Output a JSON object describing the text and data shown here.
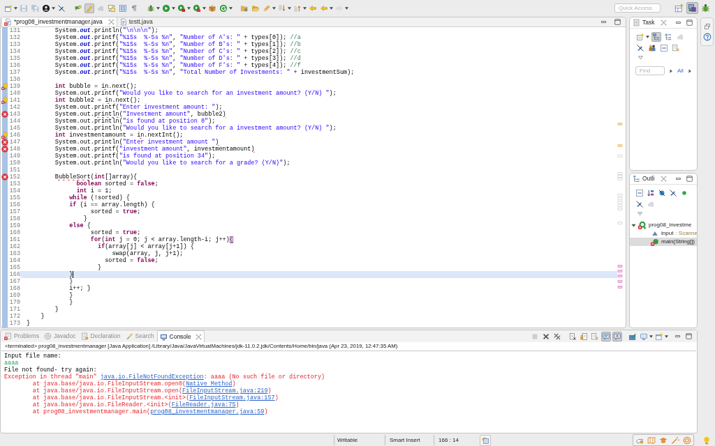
{
  "main_toolbar": [
    {
      "pressed": false,
      "disabled": false
    },
    {
      "pressed": false,
      "disabled": true
    },
    {
      "pressed": false,
      "disabled": true
    },
    {
      "pressed": false,
      "disabled": false
    },
    {
      "pressed": false,
      "disabled": false
    },
    {
      "pressed": false,
      "disabled": false
    },
    {
      "pressed": true,
      "disabled": false
    },
    {
      "pressed": false,
      "disabled": true
    },
    {
      "pressed": false,
      "disabled": false
    },
    {
      "pressed": false,
      "disabled": false
    },
    {
      "pressed": false,
      "disabled": false
    },
    {
      "pressed": false,
      "disabled": false
    },
    {
      "pressed": false,
      "disabled": false
    },
    {
      "pressed": false,
      "disabled": false
    },
    {
      "pressed": false,
      "disabled": false
    },
    {
      "pressed": false,
      "disabled": false
    },
    {
      "pressed": false,
      "disabled": false
    },
    {
      "pressed": false,
      "disabled": false
    },
    {
      "pressed": false,
      "disabled": false
    },
    {
      "pressed": false,
      "disabled": false
    },
    {
      "pressed": false,
      "disabled": false
    },
    {
      "pressed": false,
      "disabled": false
    },
    {
      "pressed": false,
      "disabled": false
    },
    {
      "pressed": false,
      "disabled": false
    },
    {
      "pressed": false,
      "disabled": true
    }
  ],
  "quick_access": {
    "placeholder": "Quick Access"
  },
  "perspectives": [
    {
      "selected": false
    },
    {
      "selected": true
    },
    {
      "selected": false
    }
  ],
  "editor": {
    "tabs": [
      {
        "label": "*prog08_investmentmanager.java",
        "selected": true,
        "error": true
      },
      {
        "label": "testt.java",
        "selected": false,
        "error": false
      }
    ],
    "lines": [
      {
        "number": "131",
        "current": false,
        "code": [
          {
            "kind": "plain",
            "text": "        System."
          },
          {
            "kind": "field",
            "text": "out"
          },
          {
            "kind": "plain",
            "text": ".println("
          },
          {
            "kind": "string",
            "text": "\"\\n\\n\\n\""
          },
          {
            "kind": "plain",
            "text": ");"
          }
        ]
      },
      {
        "number": "132",
        "current": false,
        "code": [
          {
            "kind": "plain",
            "text": "        System."
          },
          {
            "kind": "field",
            "text": "out"
          },
          {
            "kind": "plain",
            "text": ".printf("
          },
          {
            "kind": "string",
            "text": "\"%15s  %-5s %n\""
          },
          {
            "kind": "plain",
            "text": ", "
          },
          {
            "kind": "string",
            "text": "\"Number of A's: \""
          },
          {
            "kind": "plain",
            "text": " + types[0]); "
          },
          {
            "kind": "comment",
            "text": "//a"
          }
        ]
      },
      {
        "number": "133",
        "current": false,
        "code": [
          {
            "kind": "plain",
            "text": "        System."
          },
          {
            "kind": "field",
            "text": "out"
          },
          {
            "kind": "plain",
            "text": ".printf("
          },
          {
            "kind": "string",
            "text": "\"%15s  %-5s %n\""
          },
          {
            "kind": "plain",
            "text": ", "
          },
          {
            "kind": "string",
            "text": "\"Number of B's: \""
          },
          {
            "kind": "plain",
            "text": " + types[1]); "
          },
          {
            "kind": "comment",
            "text": "//b"
          }
        ]
      },
      {
        "number": "134",
        "current": false,
        "code": [
          {
            "kind": "plain",
            "text": "        System."
          },
          {
            "kind": "field",
            "text": "out"
          },
          {
            "kind": "plain",
            "text": ".printf("
          },
          {
            "kind": "string",
            "text": "\"%15s  %-5s %n\""
          },
          {
            "kind": "plain",
            "text": ", "
          },
          {
            "kind": "string",
            "text": "\"Number of C's: \""
          },
          {
            "kind": "plain",
            "text": " + types[2]); "
          },
          {
            "kind": "comment",
            "text": "//c"
          }
        ]
      },
      {
        "number": "135",
        "current": false,
        "code": [
          {
            "kind": "plain",
            "text": "        System."
          },
          {
            "kind": "field",
            "text": "out"
          },
          {
            "kind": "plain",
            "text": ".printf("
          },
          {
            "kind": "string",
            "text": "\"%15s  %-5s %n\""
          },
          {
            "kind": "plain",
            "text": ", "
          },
          {
            "kind": "string",
            "text": "\"Number of D's: \""
          },
          {
            "kind": "plain",
            "text": " + types[3]); "
          },
          {
            "kind": "comment",
            "text": "//d"
          }
        ]
      },
      {
        "number": "136",
        "current": false,
        "code": [
          {
            "kind": "plain",
            "text": "        System."
          },
          {
            "kind": "field",
            "text": "out"
          },
          {
            "kind": "plain",
            "text": ".printf("
          },
          {
            "kind": "string",
            "text": "\"%15s  %-5s %n\""
          },
          {
            "kind": "plain",
            "text": ", "
          },
          {
            "kind": "string",
            "text": "\"Number of F's: \""
          },
          {
            "kind": "plain",
            "text": " + types[4]); "
          },
          {
            "kind": "comment",
            "text": "//f"
          }
        ]
      },
      {
        "number": "137",
        "current": false,
        "code": [
          {
            "kind": "plain",
            "text": "        System."
          },
          {
            "kind": "field",
            "text": "out"
          },
          {
            "kind": "plain",
            "text": ".printf("
          },
          {
            "kind": "string",
            "text": "\"%15s  %-5s %n\""
          },
          {
            "kind": "plain",
            "text": ", "
          },
          {
            "kind": "string",
            "text": "\"Total Number of Investments: \""
          },
          {
            "kind": "plain",
            "text": " + investmentSum);"
          }
        ]
      },
      {
        "number": "138",
        "current": false
      },
      {
        "number": "139",
        "current": false,
        "marker": {
          "kind": "quickfix"
        },
        "code": [
          {
            "kind": "keyword",
            "text": "        int"
          },
          {
            "kind": "plain",
            "text": " bubble = "
          },
          {
            "kind": "error",
            "text": "in"
          },
          {
            "kind": "plain",
            "text": ".next();"
          }
        ]
      },
      {
        "number": "140",
        "current": false,
        "code": [
          {
            "kind": "plain",
            "text": "        System.out.printf("
          },
          {
            "kind": "string",
            "text": "\"Would you like to search for an investment amount? (Y/N) \""
          },
          {
            "kind": "plain",
            "text": ");"
          }
        ]
      },
      {
        "number": "141",
        "current": false,
        "marker": {
          "kind": "quickfix"
        },
        "code": [
          {
            "kind": "keyword",
            "text": "        int"
          },
          {
            "kind": "plain",
            "text": " bubble2 = "
          },
          {
            "kind": "error",
            "text": "in"
          },
          {
            "kind": "plain",
            "text": ".next();"
          }
        ]
      },
      {
        "number": "142",
        "current": false,
        "code": [
          {
            "kind": "plain",
            "text": "        System.out.printf("
          },
          {
            "kind": "string",
            "text": "\"Enter investment amount: \""
          },
          {
            "kind": "plain",
            "text": ");"
          }
        ]
      },
      {
        "number": "143",
        "current": false,
        "marker": {
          "kind": "error"
        },
        "code": [
          {
            "kind": "plain",
            "text": "        System.out."
          },
          {
            "kind": "error",
            "text": "println"
          },
          {
            "kind": "plain",
            "text": "("
          },
          {
            "kind": "string",
            "text": "\"Investment amount\""
          },
          {
            "kind": "plain",
            "text": ", bubble2"
          },
          {
            "kind": "error",
            "text": ")"
          }
        ]
      },
      {
        "number": "144",
        "current": false,
        "code": [
          {
            "kind": "plain",
            "text": "        System.out.println("
          },
          {
            "kind": "string",
            "text": "\"is found at position 0\""
          },
          {
            "kind": "plain",
            "text": ");"
          }
        ]
      },
      {
        "number": "145",
        "current": false,
        "code": [
          {
            "kind": "plain",
            "text": "        System.out.println("
          },
          {
            "kind": "string",
            "text": "\"Would you like to search for a investment amount? (Y/N) \""
          },
          {
            "kind": "plain",
            "text": ");"
          }
        ]
      },
      {
        "number": "146",
        "current": false,
        "marker": {
          "kind": "quickfix"
        },
        "code": [
          {
            "kind": "keyword",
            "text": "        int"
          },
          {
            "kind": "plain",
            "text": " investmentamount = "
          },
          {
            "kind": "error",
            "text": "in"
          },
          {
            "kind": "plain",
            "text": ".nextInt();"
          }
        ]
      },
      {
        "number": "147",
        "current": false,
        "marker": {
          "kind": "error"
        },
        "code": [
          {
            "kind": "plain",
            "text": "        System.out.println("
          },
          {
            "kind": "string",
            "text": "\"Enter investment amount \""
          },
          {
            "kind": "error",
            "text": ")"
          }
        ]
      },
      {
        "number": "148",
        "current": false,
        "marker": {
          "kind": "error"
        },
        "code": [
          {
            "kind": "plain",
            "text": "        System.out.printf("
          },
          {
            "kind": "string",
            "text": "\"investment amount\""
          },
          {
            "kind": "plain",
            "text": ", investmentamount"
          },
          {
            "kind": "error",
            "text": ")"
          }
        ]
      },
      {
        "number": "149",
        "current": false,
        "code": [
          {
            "kind": "plain",
            "text": "        System.out.printf("
          },
          {
            "kind": "string",
            "text": "\"is found at position 34\""
          },
          {
            "kind": "plain",
            "text": ");"
          }
        ]
      },
      {
        "number": "150",
        "current": false,
        "code": [
          {
            "kind": "plain",
            "text": "        System.out.println("
          },
          {
            "kind": "string",
            "text": "\"Would you like to search for a grade? (Y/N)\""
          },
          {
            "kind": "plain",
            "text": ");"
          }
        ]
      },
      {
        "number": "151",
        "current": false
      },
      {
        "number": "152",
        "current": false,
        "marker": {
          "kind": "error"
        },
        "code": [
          {
            "kind": "error",
            "text": "        BubbleSort"
          },
          {
            "kind": "plain",
            "text": "("
          },
          {
            "kind": "keyword",
            "text": "int"
          },
          {
            "kind": "error",
            "text": "[]"
          },
          {
            "kind": "plain",
            "text": "array){"
          }
        ]
      },
      {
        "number": "153",
        "current": false,
        "code": [
          {
            "kind": "keyword",
            "text": "              boolean"
          },
          {
            "kind": "plain",
            "text": " sorted = "
          },
          {
            "kind": "keyword",
            "text": "false"
          },
          {
            "kind": "plain",
            "text": ";"
          }
        ]
      },
      {
        "number": "154",
        "current": false,
        "code": [
          {
            "kind": "keyword",
            "text": "              int"
          },
          {
            "kind": "plain",
            "text": " i = 1;"
          }
        ]
      },
      {
        "number": "155",
        "current": false,
        "code": [
          {
            "kind": "keyword",
            "text": "            while"
          },
          {
            "kind": "plain",
            "text": " (!sorted) {"
          }
        ]
      },
      {
        "number": "156",
        "current": false,
        "code": [
          {
            "kind": "keyword",
            "text": "            if"
          },
          {
            "kind": "plain",
            "text": " (i == array.length) {"
          }
        ]
      },
      {
        "number": "157",
        "current": false,
        "code": [
          {
            "kind": "plain",
            "text": "                  sorted = "
          },
          {
            "kind": "keyword",
            "text": "true"
          },
          {
            "kind": "plain",
            "text": ";"
          }
        ]
      },
      {
        "number": "158",
        "current": false,
        "code": [
          {
            "kind": "plain",
            "text": "                }"
          }
        ]
      },
      {
        "number": "159",
        "current": false,
        "code": [
          {
            "kind": "keyword",
            "text": "            else"
          },
          {
            "kind": "plain",
            "text": " {"
          }
        ]
      },
      {
        "number": "160",
        "current": false,
        "code": [
          {
            "kind": "plain",
            "text": "                  sorted = "
          },
          {
            "kind": "keyword",
            "text": "true"
          },
          {
            "kind": "plain",
            "text": ";"
          }
        ]
      },
      {
        "number": "161",
        "current": false,
        "code": [
          {
            "kind": "keyword",
            "text": "                  for"
          },
          {
            "kind": "plain",
            "text": "("
          },
          {
            "kind": "keyword",
            "text": "int"
          },
          {
            "kind": "plain",
            "text": " j = 0; j < array.length-i; j++)"
          },
          {
            "kind": "match",
            "text": "{"
          }
        ]
      },
      {
        "number": "162",
        "current": false,
        "code": [
          {
            "kind": "keyword",
            "text": "                    if"
          },
          {
            "kind": "plain",
            "text": "(array[j] < array[j+1]) {"
          }
        ]
      },
      {
        "number": "163",
        "current": false,
        "code": [
          {
            "kind": "plain",
            "text": "                        swap(array, j, j+1);"
          }
        ]
      },
      {
        "number": "164",
        "current": false,
        "code": [
          {
            "kind": "plain",
            "text": "                      sorted = "
          },
          {
            "kind": "keyword",
            "text": "false"
          },
          {
            "kind": "plain",
            "text": ";"
          }
        ]
      },
      {
        "number": "165",
        "current": false,
        "code": [
          {
            "kind": "plain",
            "text": "                    }"
          }
        ]
      },
      {
        "number": "166",
        "current": true,
        "code": [
          {
            "kind": "plain",
            "text": "            }"
          }
        ]
      },
      {
        "number": "167",
        "current": false,
        "code": [
          {
            "kind": "plain",
            "text": "            }"
          }
        ]
      },
      {
        "number": "168",
        "current": false,
        "code": [
          {
            "kind": "plain",
            "text": "            i++; }"
          }
        ]
      },
      {
        "number": "169",
        "current": false,
        "code": [
          {
            "kind": "plain",
            "text": "            }"
          }
        ]
      },
      {
        "number": "170",
        "current": false,
        "code": [
          {
            "kind": "plain",
            "text": "            }"
          }
        ]
      },
      {
        "number": "171",
        "current": false,
        "code": [
          {
            "kind": "plain",
            "text": "        }"
          }
        ]
      },
      {
        "number": "172",
        "current": false,
        "code": [
          {
            "kind": "plain",
            "text": "    }"
          }
        ]
      },
      {
        "number": "173",
        "current": false,
        "code": [
          {
            "kind": "plain",
            "text": "}"
          }
        ]
      }
    ]
  },
  "task_view": {
    "title": "Task",
    "toolbar": [
      {
        "pressed": false,
        "disabled": false
      },
      {
        "pressed": true,
        "disabled": false
      },
      {
        "pressed": false,
        "disabled": false
      },
      {
        "pressed": false,
        "disabled": true
      },
      {
        "pressed": false,
        "disabled": false
      },
      {
        "pressed": false,
        "disabled": false
      },
      {
        "pressed": false,
        "disabled": false
      },
      {
        "pressed": false,
        "disabled": false
      }
    ],
    "find": {
      "placeholder": "Find"
    },
    "filter_link": "All"
  },
  "outline_view": {
    "title": "Outli",
    "toolbar": [
      {
        "disabled": false
      },
      {
        "disabled": false
      },
      {
        "disabled": false
      },
      {
        "disabled": false
      },
      {
        "disabled": false
      },
      {
        "disabled": false
      },
      {
        "disabled": true
      }
    ],
    "tree": [
      {
        "kind": "class",
        "label": "prog08_investme",
        "expanded": true,
        "selected": false,
        "children": [
          {
            "kind": "field",
            "label": "input",
            "type": ": Scanne",
            "selected": false
          },
          {
            "kind": "method",
            "label": "main(String[])",
            "selected": true
          }
        ]
      }
    ]
  },
  "bottom_panel": {
    "tabs": [
      {
        "label": "Problems",
        "selected": false
      },
      {
        "label": "Javadoc",
        "selected": false
      },
      {
        "label": "Declaration",
        "selected": false
      },
      {
        "label": "Search",
        "selected": false
      },
      {
        "label": "Console",
        "selected": true
      }
    ],
    "toolbar": [
      {
        "pressed": false,
        "disabled": true
      },
      {
        "pressed": false,
        "disabled": false
      },
      {
        "pressed": false,
        "disabled": false
      },
      {
        "pressed": false,
        "disabled": false
      },
      {
        "pressed": false,
        "disabled": false
      },
      {
        "pressed": false,
        "disabled": false
      },
      {
        "pressed": true,
        "disabled": false
      },
      {
        "pressed": true,
        "disabled": false
      },
      {
        "pressed": false,
        "disabled": false
      },
      {
        "pressed": false,
        "disabled": false
      },
      {
        "pressed": false,
        "disabled": false
      }
    ],
    "console": {
      "header": "<terminated> prog08_investmentmanager [Java Application] /Library/Java/JavaVirtualMachines/jdk-11.0.2.jdk/Contents/Home/bin/java (Apr 23, 2019, 12:47:35 AM)",
      "lines": [
        {
          "kind": "stdout",
          "parts": [
            {
              "kind": "text",
              "text": "Input file name:"
            }
          ]
        },
        {
          "kind": "stdin",
          "parts": [
            {
              "kind": "text",
              "text": "aaaa"
            }
          ]
        },
        {
          "kind": "stdout",
          "parts": [
            {
              "kind": "text",
              "text": "File not found- try again:"
            }
          ]
        },
        {
          "kind": "stderr",
          "parts": [
            {
              "kind": "text",
              "text": "Exception in thread \"main\" "
            },
            {
              "kind": "link",
              "text": "java.io.FileNotFoundException"
            },
            {
              "kind": "text",
              "text": ": aaaa (No such file or directory)"
            }
          ]
        },
        {
          "kind": "stderr",
          "parts": [
            {
              "kind": "text",
              "text": "\tat java.base/java.io.FileInputStream.open0("
            },
            {
              "kind": "link",
              "text": "Native Method"
            },
            {
              "kind": "text",
              "text": ")"
            }
          ]
        },
        {
          "kind": "stderr",
          "parts": [
            {
              "kind": "text",
              "text": "\tat java.base/java.io.FileInputStream.open("
            },
            {
              "kind": "link",
              "text": "FileInputStream.java:219"
            },
            {
              "kind": "text",
              "text": ")"
            }
          ]
        },
        {
          "kind": "stderr",
          "parts": [
            {
              "kind": "text",
              "text": "\tat java.base/java.io.FileInputStream.<init>("
            },
            {
              "kind": "link",
              "text": "FileInputStream.java:157"
            },
            {
              "kind": "text",
              "text": ")"
            }
          ]
        },
        {
          "kind": "stderr",
          "parts": [
            {
              "kind": "text",
              "text": "\tat java.base/java.io.FileReader.<init>("
            },
            {
              "kind": "link",
              "text": "FileReader.java:75"
            },
            {
              "kind": "text",
              "text": ")"
            }
          ]
        },
        {
          "kind": "stderr",
          "parts": [
            {
              "kind": "text",
              "text": "\tat prog08_investmentmanager.main("
            },
            {
              "kind": "link",
              "text": "prog08_investmentmanager.java:59"
            },
            {
              "kind": "text",
              "text": ")"
            }
          ]
        }
      ]
    }
  },
  "status_bar": {
    "write_mode": "Writable",
    "insert_mode": "Smart Insert",
    "cursor_position": "166 : 14"
  }
}
